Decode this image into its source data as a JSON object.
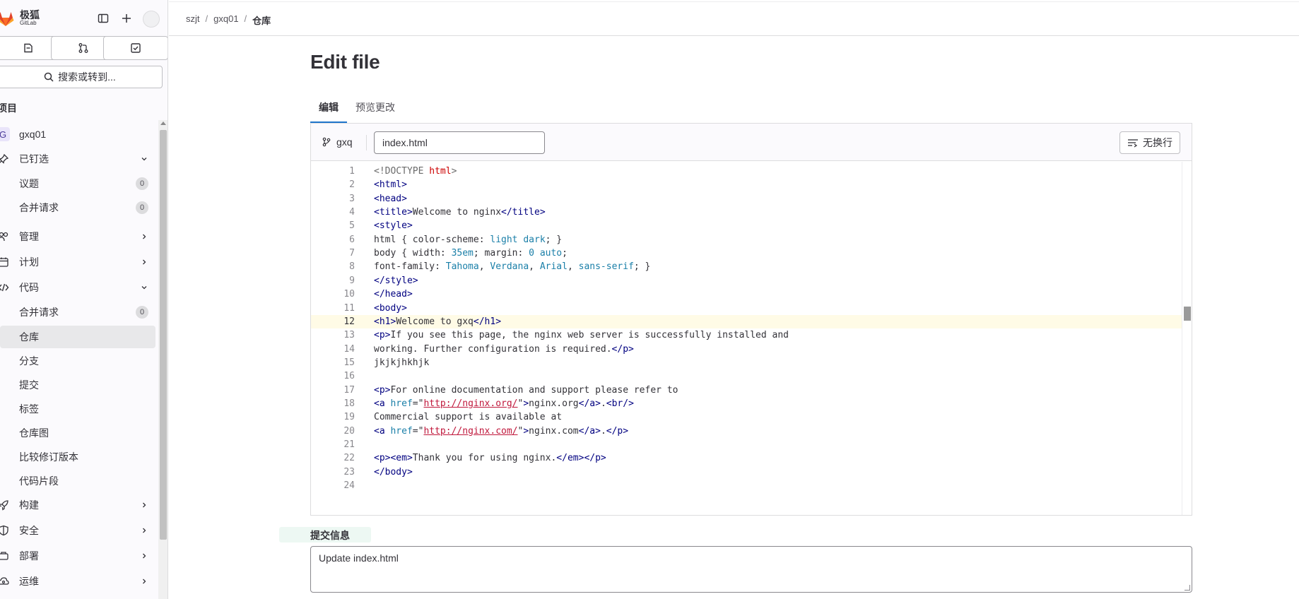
{
  "brand": {
    "name": "极狐",
    "sub": "GitLab"
  },
  "sidebar": {
    "search_label": "搜索或转到...",
    "section_title": "项目",
    "project": {
      "initial": "G",
      "name": "gxq01"
    },
    "items": [
      {
        "label": "已钉选",
        "type": "group-open"
      },
      {
        "label": "议题",
        "badge": "0"
      },
      {
        "label": "合并请求",
        "badge": "0"
      },
      {
        "label": "管理",
        "type": "group"
      },
      {
        "label": "计划",
        "type": "group"
      },
      {
        "label": "代码",
        "type": "group-open"
      },
      {
        "label": "合并请求",
        "badge": "0"
      },
      {
        "label": "仓库",
        "active": true
      },
      {
        "label": "分支"
      },
      {
        "label": "提交"
      },
      {
        "label": "标签"
      },
      {
        "label": "仓库图"
      },
      {
        "label": "比较修订版本"
      },
      {
        "label": "代码片段"
      },
      {
        "label": "构建",
        "type": "group"
      },
      {
        "label": "安全",
        "type": "group"
      },
      {
        "label": "部署",
        "type": "group"
      },
      {
        "label": "运维",
        "type": "group"
      }
    ]
  },
  "breadcrumb": [
    "szjt",
    "gxq01",
    "仓库"
  ],
  "page_title": "Edit file",
  "tabs": [
    {
      "label": "编辑",
      "active": true
    },
    {
      "label": "预览更改",
      "active": false
    }
  ],
  "editor": {
    "branch": "gxq",
    "filename": "index.html",
    "wrap_label": "无换行",
    "current_line": 12,
    "lines": [
      "<!DOCTYPE html>",
      "<html>",
      "<head>",
      "<title>Welcome to nginx</title>",
      "<style>",
      "html { color-scheme: light dark; }",
      "body { width: 35em; margin: 0 auto;",
      "font-family: Tahoma, Verdana, Arial, sans-serif; }",
      "</style>",
      "</head>",
      "<body>",
      "<h1>Welcome to gxq</h1>",
      "<p>If you see this page, the nginx web server is successfully installed and",
      "working. Further configuration is required.</p>",
      "jkjkjhkhjk",
      "",
      "<p>For online documentation and support please refer to",
      "<a href=\"http://nginx.org/\">nginx.org</a>.<br/>",
      "Commercial support is available at",
      "<a href=\"http://nginx.com/\">nginx.com</a>.</p>",
      "",
      "<p><em>Thank you for using nginx.</em></p>",
      "</body>",
      ""
    ]
  },
  "commit": {
    "label": "提交信息",
    "message": "Update index.html"
  }
}
